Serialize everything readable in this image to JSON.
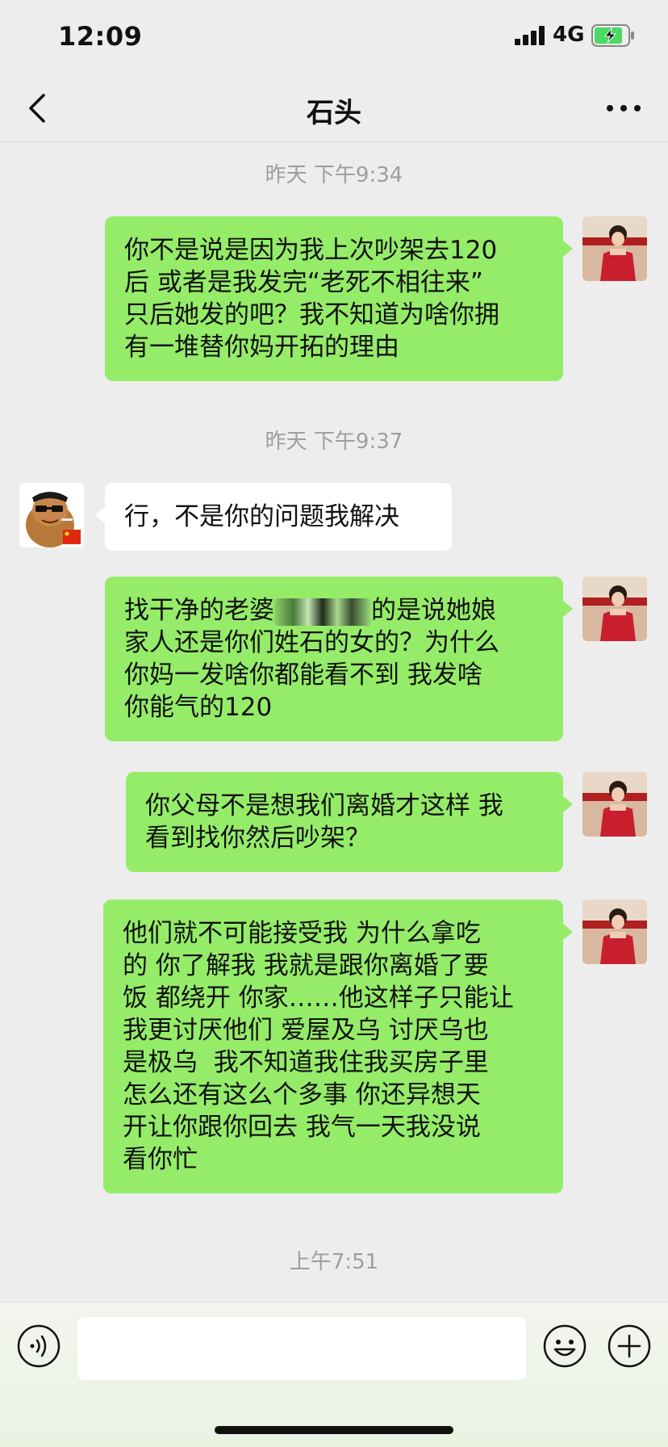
{
  "status_bar": {
    "time": "12:09",
    "network": "4G"
  },
  "nav": {
    "title": "石头",
    "back_icon": "chevron-left-icon",
    "more_icon": "more-horizontal-icon"
  },
  "messages": {
    "ts1": "昨天 下午9:34",
    "m1": "你不是说是因为我上次吵架去120\n后 或者是我发完“老死不相往来”\n只后她发的吧？我不知道为啥你拥\n有一堆替你妈开拓的理由",
    "ts2": "昨天 下午9:37",
    "m2": "行，不是你的问题我解决",
    "m3_a": "找干净的老婆",
    "m3_b": "的是说她娘\n家人还是你们姓石的女的？为什么\n你妈一发啥你都能看不到 我发啥\n你能气的120",
    "m4": "你父母不是想我们离婚才这样 我\n看到找你然后吵架？",
    "m5": "他们就不可能接受我 为什么拿吃\n的 你了解我 我就是跟你离婚了要\n饭 都绕开 你家……他这样子只能让\n我更讨厌他们 爱屋及乌 讨厌乌也\n是极乌  我不知道我住我买房子里\n怎么还有这么个多事 你还异想天\n开让你跟你回去 我气一天我没说\n看你忙",
    "ts3": "上午7:51"
  },
  "input_bar": {
    "placeholder": ""
  },
  "colors": {
    "outgoing_bubble": "#95ec69",
    "incoming_bubble": "#ffffff",
    "background": "#ededed"
  }
}
